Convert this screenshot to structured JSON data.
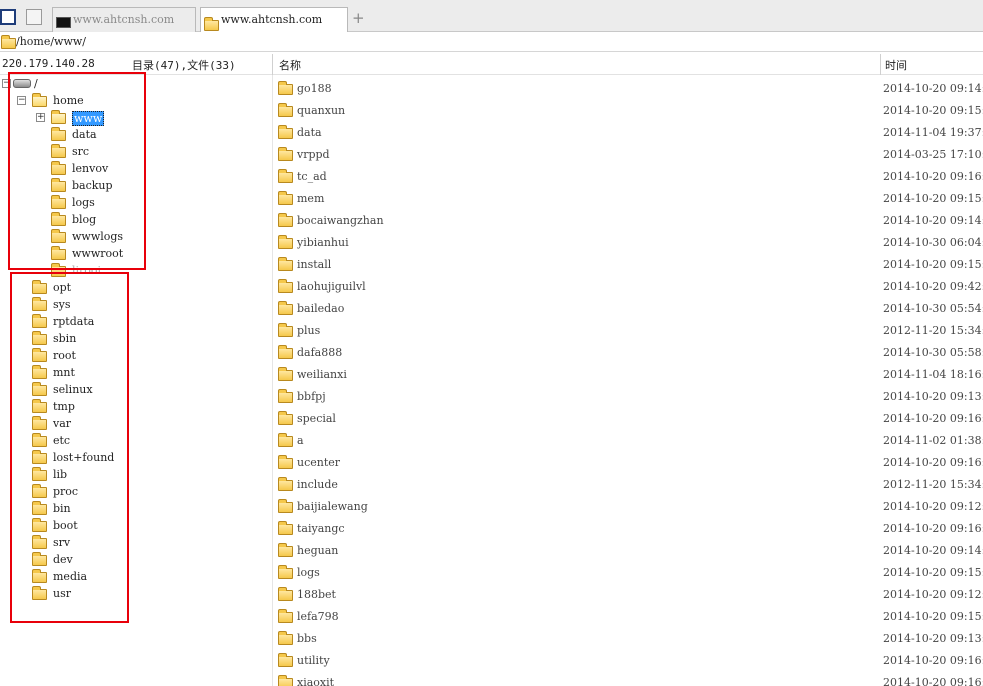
{
  "tabs": [
    {
      "label": "www.ahtcnsh.com",
      "icon": "terminal-icon",
      "active": false
    },
    {
      "label": "www.ahtcnsh.com",
      "icon": "folder-icon",
      "active": true
    }
  ],
  "new_tab_label": "+",
  "address": "/home/www/",
  "header": {
    "ip": "220.179.140.28",
    "counts": "目录(47),文件(33)",
    "col_name": "名称",
    "col_time": "时间"
  },
  "tree": {
    "root": "/",
    "home": "home",
    "selected": "www",
    "home_children": [
      "data",
      "src",
      "lenvov",
      "backup",
      "logs",
      "blog",
      "wwwlogs",
      "wwwroot",
      "lirooi"
    ],
    "root_children": [
      "opt",
      "sys",
      "rptdata",
      "sbin",
      "root",
      "mnt",
      "selinux",
      "tmp",
      "var",
      "etc",
      "lost+found",
      "lib",
      "proc",
      "bin",
      "boot",
      "srv",
      "dev",
      "media",
      "usr"
    ]
  },
  "files": [
    {
      "name": "go188",
      "time": "2014-10-20 09:14:"
    },
    {
      "name": "quanxun",
      "time": "2014-10-20 09:15:"
    },
    {
      "name": "data",
      "time": "2014-11-04 19:37:"
    },
    {
      "name": "vrppd",
      "time": "2014-03-25 17:10:"
    },
    {
      "name": "tc_ad",
      "time": "2014-10-20 09:16:"
    },
    {
      "name": "mem",
      "time": "2014-10-20 09:15:"
    },
    {
      "name": "bocaiwangzhan",
      "time": "2014-10-20 09:14:"
    },
    {
      "name": "yibianhui",
      "time": "2014-10-30 06:04:"
    },
    {
      "name": "install",
      "time": "2014-10-20 09:15:"
    },
    {
      "name": "laohujiguilvl",
      "time": "2014-10-20 09:42:"
    },
    {
      "name": "bailedao",
      "time": "2014-10-30 05:54:"
    },
    {
      "name": "plus",
      "time": "2012-11-20 15:34:"
    },
    {
      "name": "dafa888",
      "time": "2014-10-30 05:58:"
    },
    {
      "name": "weilianxi",
      "time": "2014-11-04 18:16:"
    },
    {
      "name": "bbfpj",
      "time": "2014-10-20 09:13:"
    },
    {
      "name": "special",
      "time": "2014-10-20 09:16:"
    },
    {
      "name": "a",
      "time": "2014-11-02 01:38:"
    },
    {
      "name": "ucenter",
      "time": "2014-10-20 09:16:"
    },
    {
      "name": "include",
      "time": "2012-11-20 15:34:"
    },
    {
      "name": "baijialewang",
      "time": "2014-10-20 09:12:"
    },
    {
      "name": "taiyangc",
      "time": "2014-10-20 09:16:"
    },
    {
      "name": "heguan",
      "time": "2014-10-20 09:14:"
    },
    {
      "name": "logs",
      "time": "2014-10-20 09:15:"
    },
    {
      "name": "188bet",
      "time": "2014-10-20 09:12:"
    },
    {
      "name": "lefa798",
      "time": "2014-10-20 09:15:"
    },
    {
      "name": "bbs",
      "time": "2014-10-20 09:13:"
    },
    {
      "name": "utility",
      "time": "2014-10-20 09:16:"
    },
    {
      "name": "xiaoxit",
      "time": "2014-10-20 09:16:"
    }
  ],
  "colors": {
    "highlight_box": "#e8000a",
    "selection": "#3399ff"
  }
}
